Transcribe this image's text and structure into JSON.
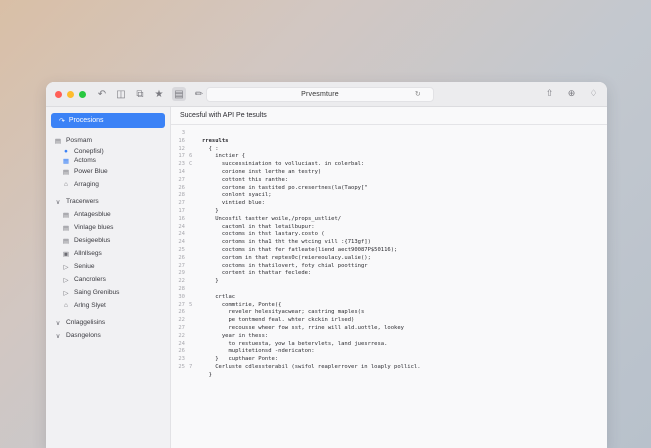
{
  "window": {
    "url_title": "Prvesmture",
    "traffic_lights": [
      "#ff5f57",
      "#febc2e",
      "#28c840"
    ],
    "toolbar_icons": [
      "back-icon",
      "sidebar-icon",
      "window-icon",
      "extensions-icon",
      "reader-icon",
      "edit-icon"
    ],
    "right_icons": [
      "share-icon",
      "zoom-icon",
      "lock-icon"
    ]
  },
  "sidebar": {
    "selected": "Procesions",
    "items": [
      {
        "label": "Posmam",
        "icon": "folder-icon",
        "level": 0
      },
      {
        "label": "Conepfisl)",
        "icon": "dot-icon",
        "level": 2,
        "blue": true
      },
      {
        "label": "Actoms",
        "icon": "grid-icon",
        "level": 2,
        "blue": true
      },
      {
        "label": "Power Blue",
        "icon": "doc-icon",
        "level": 1
      },
      {
        "label": "Arraging",
        "icon": "tag-icon",
        "level": 1
      },
      {
        "label": "Tracerwers",
        "icon": "chevron-down-icon",
        "level": 0
      },
      {
        "label": "Antagesblue",
        "icon": "doc-icon",
        "level": 1
      },
      {
        "label": "Vinlage blues",
        "icon": "folder-icon",
        "level": 1
      },
      {
        "label": "Desigeeblus",
        "icon": "folder-icon",
        "level": 1
      },
      {
        "label": "Allnllsegs",
        "icon": "user-icon",
        "level": 1
      },
      {
        "label": "Seniue",
        "icon": "chevron-right-icon",
        "level": 1
      },
      {
        "label": "Cancrolers",
        "icon": "chevron-right-icon",
        "level": 1
      },
      {
        "label": "Saing Grenibus",
        "icon": "chevron-right-icon",
        "level": 1
      },
      {
        "label": "Arlng Slyet",
        "icon": "tag-icon",
        "level": 1
      },
      {
        "label": "Cnlaggelisins",
        "icon": "chevron-down-icon",
        "level": 0
      },
      {
        "label": "Dasngelons",
        "icon": "chevron-down-icon",
        "level": 0
      }
    ]
  },
  "main": {
    "header": "Sucesful with API Pe tesults",
    "lines": [
      {
        "n": "3",
        "m": "",
        "t": ""
      },
      {
        "n": "16",
        "m": "",
        "t": "rresults"
      },
      {
        "n": "12",
        "m": "",
        "t": "  { :"
      },
      {
        "n": "17",
        "m": "6",
        "t": "    inctier {"
      },
      {
        "n": "23",
        "m": "C",
        "t": "      successiniation to volluciast. in colerbal:"
      },
      {
        "n": "14",
        "m": "",
        "t": "      corione inst lerthe an testry)"
      },
      {
        "n": "27",
        "m": "",
        "t": "      cottont this ranthe:"
      },
      {
        "n": "26",
        "m": "",
        "t": "      cortone in tastited po.cresertnes(la(Taopy[\""
      },
      {
        "n": "28",
        "m": "",
        "t": "      conlont syacil;"
      },
      {
        "n": "27",
        "m": "",
        "t": "      vintied blue:"
      },
      {
        "n": "17",
        "m": "",
        "t": "    }"
      },
      {
        "n": "16",
        "m": "",
        "t": "    Uncosfil tastter woile,/props_ustliet/"
      },
      {
        "n": "24",
        "m": "",
        "t": "      cactoml in that letailbupur:"
      },
      {
        "n": "24",
        "m": "",
        "t": "      coctoms in thst lastary.costo ("
      },
      {
        "n": "24",
        "m": "",
        "t": "      cortoms in tha1 tht the wtcing vill :{713gf])"
      },
      {
        "n": "25",
        "m": "",
        "t": "      coctoms in that fer fatleate(liend aect90087P$50116);"
      },
      {
        "n": "26",
        "m": "",
        "t": "      cortom in that reptes0c(reiereoulacy.ualie();"
      },
      {
        "n": "27",
        "m": "",
        "t": "      coctoms in thatilovert, foty chial poottingr"
      },
      {
        "n": "29",
        "m": "",
        "t": "      cortent in thattar feclede:"
      },
      {
        "n": "22",
        "m": "",
        "t": "    }"
      },
      {
        "n": "28",
        "m": "",
        "t": ""
      },
      {
        "n": "30",
        "m": "",
        "t": "    crtlac"
      },
      {
        "n": "27",
        "m": "5",
        "t": "      commtirie, Ponte({"
      },
      {
        "n": "26",
        "m": "",
        "t": "        reveler helesityacwear; castring maples(s"
      },
      {
        "n": "22",
        "m": "",
        "t": "        pe tontmend feal. whter ckckin irlsed)"
      },
      {
        "n": "27",
        "m": "",
        "t": "        recousse wheer fow sst, rrine will ald.uottle, lookey"
      },
      {
        "n": "22",
        "m": "",
        "t": "      year in thess:"
      },
      {
        "n": "24",
        "m": "",
        "t": "        to restuesta, yow la betervlets, land juesrresa."
      },
      {
        "n": "26",
        "m": "",
        "t": "        muplitetionsd -ndericaton:"
      },
      {
        "n": "23",
        "m": "",
        "t": "    }   cupthaer Ponte:"
      },
      {
        "n": "25",
        "m": "7",
        "t": "    Cerluste cdlessterabil (swifol reaplerrover in loaply pollicl."
      },
      {
        "n": "",
        "m": "",
        "t": "  }"
      }
    ]
  }
}
